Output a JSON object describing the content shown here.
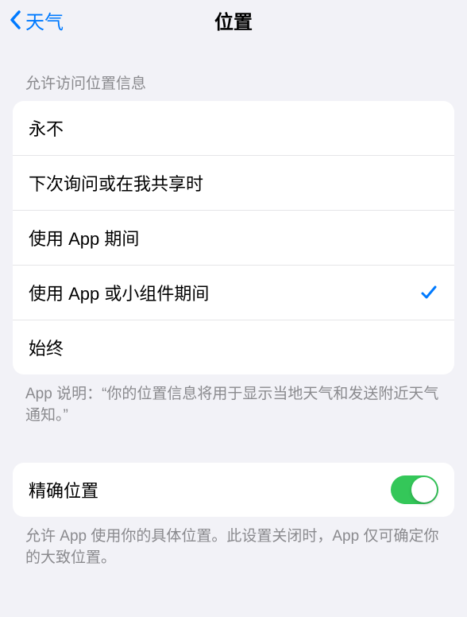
{
  "nav": {
    "back_label": "天气",
    "title": "位置"
  },
  "section1": {
    "header": "允许访问位置信息",
    "options": [
      {
        "label": "永不",
        "selected": false
      },
      {
        "label": "下次询问或在我共享时",
        "selected": false
      },
      {
        "label": "使用 App 期间",
        "selected": false
      },
      {
        "label": "使用 App 或小组件期间",
        "selected": true
      },
      {
        "label": "始终",
        "selected": false
      }
    ],
    "footer": "App 说明：“你的位置信息将用于显示当地天气和发送附近天气通知。”"
  },
  "section2": {
    "precise_location_label": "精确位置",
    "precise_location_enabled": true,
    "footer": "允许 App 使用你的具体位置。此设置关闭时，App 仅可确定你的大致位置。"
  }
}
